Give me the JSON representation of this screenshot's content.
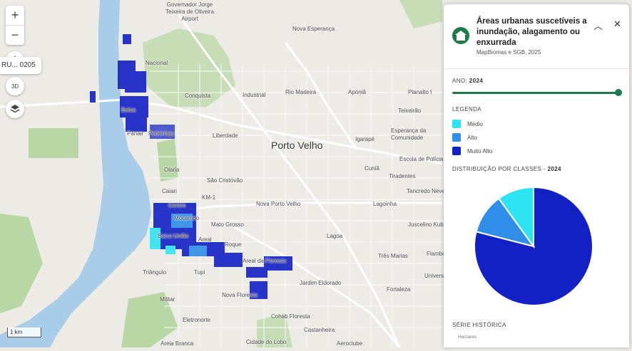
{
  "map": {
    "city_name": "Porto Velho",
    "airport_label": "Governador Jorge Teixeira de Oliveira Airport",
    "search_chip_text": "RU... 0205",
    "scale_label": "1 km",
    "labels": [
      "Nova Esperança",
      "Nacional",
      "Conquista",
      "Industrial",
      "Rio Madeira",
      "Aponiã",
      "Planalto I",
      "Teixeirão",
      "Esperança da Comunidade",
      "Panair",
      "Pedrinhas",
      "Liberdade",
      "Igarapé",
      "Escola de Polícia",
      "Olaria",
      "São Cristóvão",
      "Cuniã",
      "Tiradentes",
      "Caiari",
      "KM-1",
      "Tancredo Neves",
      "Centro",
      "Nova Porto Velho",
      "Lagoinha",
      "Mocambo",
      "Mato Grosso",
      "Juscelino Kubitschek",
      "Baixa União",
      "Areal",
      "Lagoa",
      "Roque",
      "Três Marias",
      "Flamboyant",
      "Triângulo",
      "Tupi",
      "Areal da Floresta",
      "Universidade",
      "Militar",
      "Nova Floresta",
      "Jardim Eldorado",
      "Fortaleza",
      "Eletronorte",
      "Cohab Floresta",
      "Castanheira",
      "Areia Branca",
      "Cidade do Lobo",
      "Aeroclube",
      "Balsa"
    ],
    "icons": [
      "zoom-in-icon",
      "zoom-out-icon",
      "compass-icon",
      "3d-icon",
      "layers-icon"
    ],
    "labels_3d": "3D"
  },
  "panel": {
    "title": "Áreas urbanas suscetíveis a inundação, alagamento ou enxurrada",
    "subtitle": "MapBiomas e SGB, 2025",
    "year_label": "ANO:",
    "year_value": "2024",
    "year_slider_fraction": 1.0,
    "legend_label": "LEGENDA",
    "legend": [
      {
        "label": "Médio",
        "color": "#2fe4f2"
      },
      {
        "label": "Alto",
        "color": "#2f8fe8"
      },
      {
        "label": "Muito Alto",
        "color": "#1320c4"
      }
    ],
    "distribution_label": "DISTRIBUIÇÃO POR CLASSES -",
    "distribution_year": "2024",
    "series_label": "SÉRIE HISTÓRICA",
    "series_unit": "Hectares",
    "icons": [
      "mapbiomas-logo-icon",
      "chevron-up-icon",
      "close-icon"
    ]
  },
  "chart_data": {
    "type": "pie",
    "categories": [
      "Muito Alto",
      "Alto",
      "Médio"
    ],
    "values": [
      79,
      11,
      10
    ],
    "colors": [
      "#1320c4",
      "#2f8fe8",
      "#2fe4f2"
    ]
  }
}
